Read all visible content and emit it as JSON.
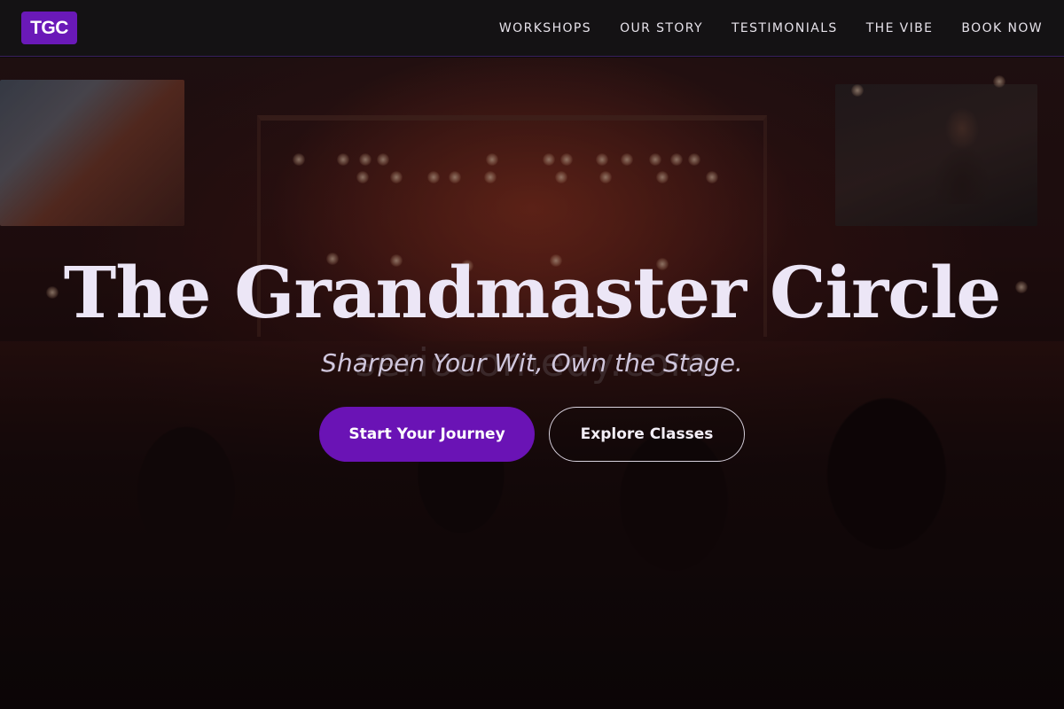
{
  "brand": {
    "logo_text": "TGC",
    "accent_color": "#6a19b8"
  },
  "nav": {
    "items": [
      {
        "label": "WORKSHOPS"
      },
      {
        "label": "OUR STORY"
      },
      {
        "label": "TESTIMONIALS"
      },
      {
        "label": "THE VIBE"
      },
      {
        "label": "BOOK NOW"
      }
    ]
  },
  "hero": {
    "title": "The Grandmaster Circle",
    "tagline": "Sharpen Your Wit, Own the Stage.",
    "watermark": "seriocomedy.com",
    "primary_button": "Start Your Journey",
    "secondary_button": "Explore Classes",
    "background": "concert-crowd-stage-photo"
  }
}
